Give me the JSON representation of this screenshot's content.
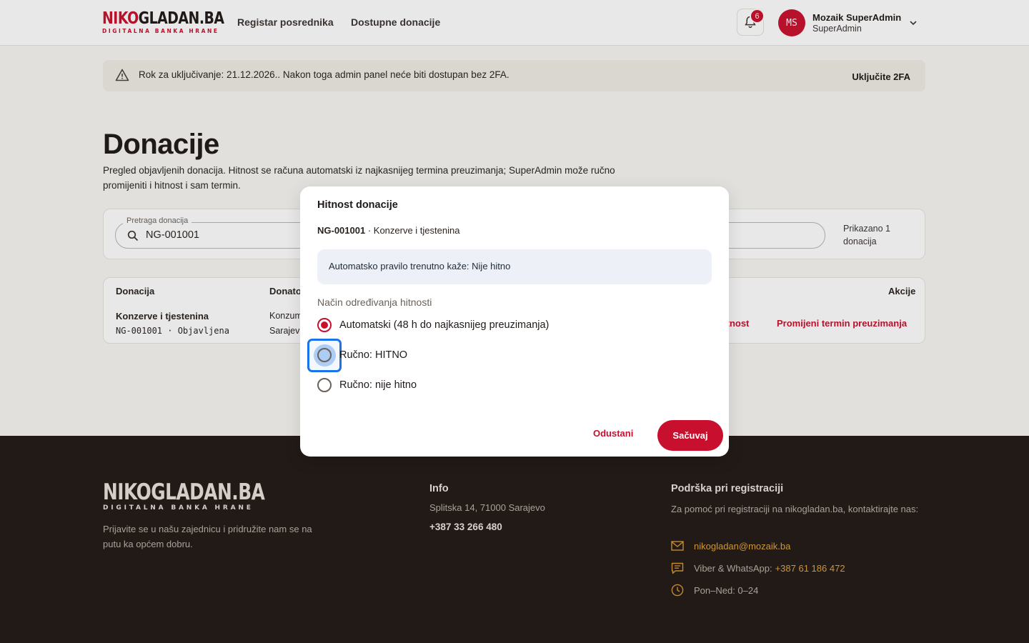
{
  "header": {
    "logo_main_a": "NIKO",
    "logo_main_b": "GLADAN.BA",
    "logo_sub": "DIGITALNA BANKA HRANE",
    "nav": [
      "Registar posrednika",
      "Dostupne donacije"
    ],
    "notification_count": "6",
    "user": {
      "initials": "MS",
      "name": "Mozaik SuperAdmin",
      "role": "SuperAdmin"
    }
  },
  "notice": {
    "text": "Rok za uključivanje: 21.12.2026.. Nakon toga admin panel neće biti dostupan bez 2FA.",
    "action": "Uključite 2FA"
  },
  "page": {
    "title": "Donacije",
    "description": "Pregled objavljenih donacija. Hitnost se računa automatski iz najkasnijeg termina preuzimanja; SuperAdmin može ručno promijeniti i hitnost i sam termin."
  },
  "search": {
    "label": "Pretraga donacija",
    "value": "NG-001001",
    "shown_count": "Prikazano 1 donacija"
  },
  "table": {
    "columns": [
      "Donacija",
      "Donato",
      "Akcije"
    ],
    "rows": [
      {
        "title": "Konzerve i tjestenina",
        "code": "NG-001001 · Objavljena",
        "donor_line1": "Konzum",
        "donor_line2": "Sarajevo",
        "action_urgency": "itnost",
        "action_pickup": "Promijeni termin preuzimanja"
      }
    ]
  },
  "footer": {
    "logo_main": "NIKOGLADAN.BA",
    "logo_sub": "DIGITALNA BANKA HRANE",
    "tagline": "Prijavite se u našu zajednicu i pridružite nam se na putu ka općem dobru.",
    "info_heading": "Info",
    "address": "Splitska 14, 71000 Sarajevo",
    "phone": "+387 33 266 480",
    "support_heading": "Podrška pri registraciji",
    "support_text": "Za pomoć pri registraciji na nikogladan.ba, kontaktirajte nas:",
    "email": "nikogladan@mozaik.ba",
    "viber_label": "Viber & WhatsApp: ",
    "viber_number": "+387 61 186 472",
    "hours": "Pon–Ned: 0–24"
  },
  "modal": {
    "title": "Hitnost donacije",
    "code": "NG-001001",
    "name": " · Konzerve i tjestenina",
    "info": "Automatsko pravilo trenutno kaže: Nije hitno",
    "legend": "Način određivanja hitnosti",
    "options": [
      {
        "label": "Automatski (48 h do najkasnijeg preuzimanja)",
        "checked": true
      },
      {
        "label": "Ručno: HITNO",
        "checked": false,
        "focused": true
      },
      {
        "label": "Ručno: nije hitno",
        "checked": false
      }
    ],
    "cancel": "Odustani",
    "save": "Sačuvaj"
  },
  "colors": {
    "brand_red": "#c8102e",
    "footer_bg": "#211a16",
    "accent_gold": "#e0a33b",
    "focus_blue": "#1a73e8"
  }
}
